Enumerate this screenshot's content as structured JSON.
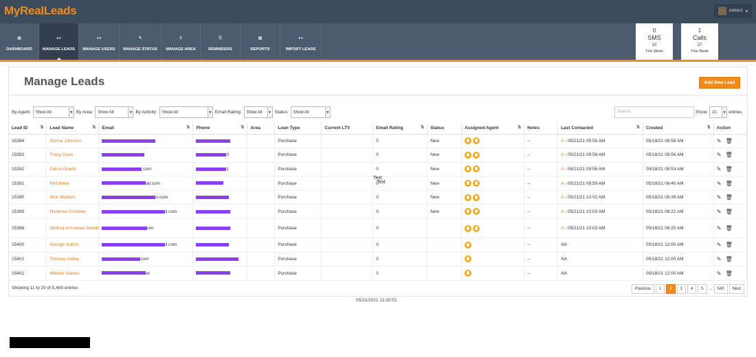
{
  "app": {
    "logo": "MyRealLeads",
    "user": "Admin1"
  },
  "nav": [
    {
      "label": "DASHBOARD",
      "icon": "monitor-icon"
    },
    {
      "label": "MANAGE LEADS",
      "icon": "users-icon",
      "active": true
    },
    {
      "label": "MANAGE USERS",
      "icon": "users-icon"
    },
    {
      "label": "MANAGE STATUS",
      "icon": "status-edit-icon"
    },
    {
      "label": "MANAGE AREA",
      "icon": "map-pin-icon"
    },
    {
      "label": "REMINDERS",
      "icon": "list-icon"
    },
    {
      "label": "REPORTS",
      "icon": "bar-chart-icon"
    },
    {
      "label": "IMPORT LEADS",
      "icon": "users-icon"
    }
  ],
  "stats": [
    {
      "value": "0",
      "label": "SMS",
      "sub": "10",
      "period": "This Week"
    },
    {
      "value": "1",
      "label": "Calls",
      "sub": "27",
      "period": "This Week"
    }
  ],
  "page": {
    "title": "Manage Leads",
    "add_button": "Add New Lead"
  },
  "filters": {
    "agent_label": "By Agent:",
    "agent_value": "Show All",
    "area_label": "By Area:",
    "area_value": "Show All",
    "activity_label": "By Activity:",
    "activity_value": "Show All",
    "email_label": "Email Rating:",
    "email_value": "Show All",
    "status_label": "Status:",
    "status_value": "Show All",
    "search_placeholder": "Search",
    "show_label": "Show:",
    "show_value": "10",
    "entries_label": "entries"
  },
  "table": {
    "headers": [
      "Lead ID",
      "Lead Name",
      "Email",
      "Phone",
      "Area",
      "Loan Type",
      "Current LTV",
      "Email Rating",
      "Status",
      "Assigned Agent",
      "Notes",
      "Last Contacted",
      "Created",
      "Action"
    ],
    "rows": [
      {
        "id": "15394",
        "name": "Donna Johnson",
        "email_tail": "",
        "phone_tail": "",
        "loan": "Purchase",
        "rating": "0",
        "status": "New",
        "agents": 2,
        "notes": "--",
        "contact_prefix": "A",
        "contact": " - 05/21/21 09:55 AM",
        "created": "05/18/21 08:58 AM"
      },
      {
        "id": "15393",
        "name": "Tracy Crum",
        "email_tail": "",
        "phone_tail": "0",
        "loan": "Purchase",
        "rating": "0",
        "status": "New",
        "agents": 2,
        "notes": "--",
        "contact_prefix": "A",
        "contact": " - 05/21/21 09:56 AM",
        "created": "05/18/21 08:56 AM"
      },
      {
        "id": "15392",
        "name": "Zahra Gharib",
        "email_tail": ".com",
        "phone_tail": "1",
        "loan": "Purchase",
        "rating": "0",
        "status": "New",
        "agents": 2,
        "notes": "--",
        "contact_prefix": "A",
        "contact": " - 05/21/21 09:56 AM",
        "created": "05/18/21 08:53 AM"
      },
      {
        "id": "15391",
        "name": "Phil Brew",
        "email_tail": "ail.com",
        "phone_tail": "",
        "loan": "Purchase",
        "rating": "0",
        "status": "New",
        "agents": 2,
        "notes": "--",
        "contact_prefix": "A",
        "contact": " - 05/21/21 09:59 AM",
        "created": "05/18/21 08:40 AM"
      },
      {
        "id": "15390",
        "name": "Nick Watkins",
        "email_tail": "o.com",
        "phone_tail": "",
        "loan": "Purchase",
        "rating": "0",
        "status": "New",
        "agents": 2,
        "notes": "--",
        "contact_prefix": "A",
        "contact": " - 05/21/21 10:02 AM",
        "created": "05/18/21 08:39 AM"
      },
      {
        "id": "15389",
        "name": "Hortense Crowner",
        "email_tail": "il.com",
        "phone_tail": "",
        "loan": "Purchase",
        "rating": "0",
        "status": "New",
        "agents": 2,
        "notes": "--",
        "contact_prefix": "A",
        "contact": " - 05/21/21 10:03 AM",
        "created": "05/18/21 08:22 AM"
      },
      {
        "id": "15388",
        "name": "Andrea Armstead-Jarrett",
        "email_tail": "om",
        "phone_tail": "",
        "loan": "Purchase",
        "rating": "0",
        "status": "",
        "agents": 2,
        "notes": "--",
        "contact_prefix": "A",
        "contact": " - 05/21/21 10:03 AM",
        "created": "05/18/21 08:20 AM",
        "tall": true
      },
      {
        "id": "15400",
        "name": "George Sutton",
        "email_tail": "il.com",
        "phone_tail": "",
        "loan": "Purchase",
        "rating": "0",
        "status": "",
        "agents": 1,
        "notes": "--",
        "contact_prefix": "",
        "contact": "NA",
        "created": "05/18/21 12:00 AM"
      },
      {
        "id": "15401",
        "name": "Thomas Salley",
        "email_tail": "com",
        "phone_tail": "",
        "loan": "Purchase",
        "rating": "0",
        "status": "",
        "agents": 1,
        "notes": "--",
        "contact_prefix": "",
        "contact": "NA",
        "created": "05/18/21 12:00 AM"
      },
      {
        "id": "15402",
        "name": "William Gaines",
        "email_tail": "et",
        "phone_tail": "",
        "loan": "Purchase",
        "rating": "0",
        "status": "",
        "agents": 1,
        "notes": "--",
        "contact_prefix": "",
        "contact": "NA",
        "created": "05/18/21 12:00 AM"
      }
    ]
  },
  "footer": {
    "info": "Showing 11 to 20 of 5,400 entries"
  },
  "pagination": [
    "Previous",
    "1",
    "2",
    "3",
    "4",
    "5",
    "...",
    "540",
    "Next"
  ],
  "overlay": [
    "Text",
    "Text"
  ],
  "timestamp": "05/21/2021 12:20:51",
  "colors": {
    "brand": "#f08c1c",
    "nav": "#4d5b70",
    "topbar": "#3c4a5c",
    "redaction": "#8a3ff0"
  }
}
